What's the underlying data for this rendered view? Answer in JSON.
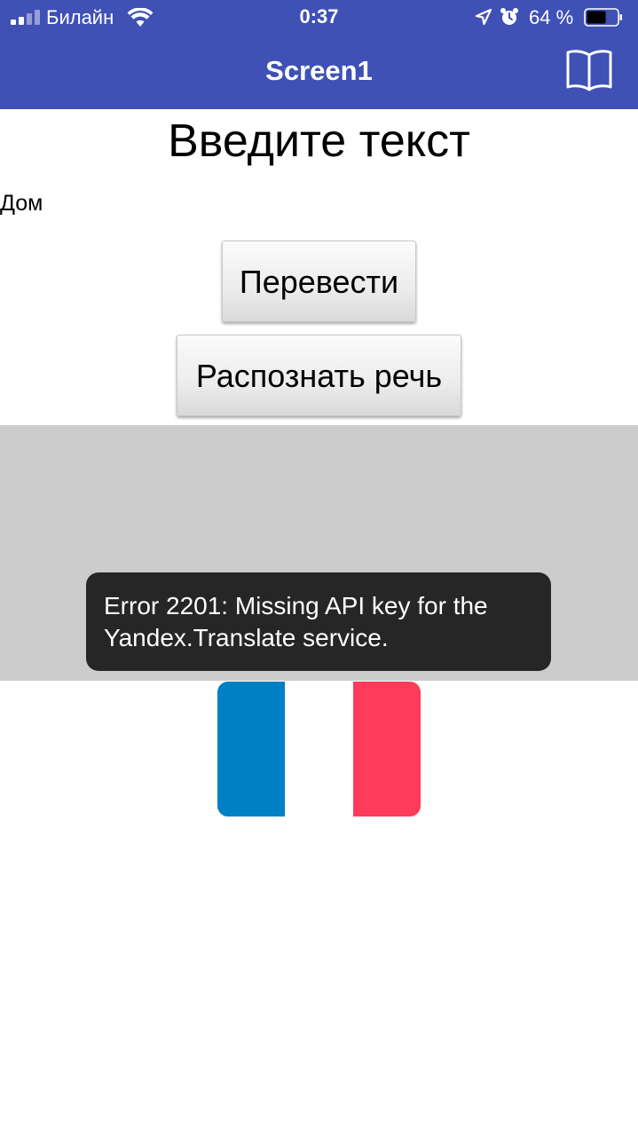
{
  "status_bar": {
    "carrier": "Билайн",
    "time": "0:37",
    "battery_percent": "64 %",
    "battery_level": 0.64,
    "signal_bars": 2,
    "icons": [
      "signal-icon",
      "wifi-icon",
      "location-arrow-icon",
      "alarm-clock-icon",
      "battery-icon"
    ]
  },
  "app_bar": {
    "title": "Screen1",
    "book_icon": "book-icon"
  },
  "main": {
    "heading": "Введите текст",
    "input_value": "Дом",
    "translate_button": "Перевести",
    "speech_button": "Распознать речь"
  },
  "toast": {
    "message": "Error 2201: Missing API key for the Yandex.Translate service."
  },
  "flag": {
    "name": "french-flag",
    "colors": [
      "#0080c4",
      "#ffffff",
      "#fc3c5a"
    ]
  },
  "colors": {
    "app_bar": "#3f51b5",
    "panel": "#cccccc",
    "toast": "#262626"
  }
}
